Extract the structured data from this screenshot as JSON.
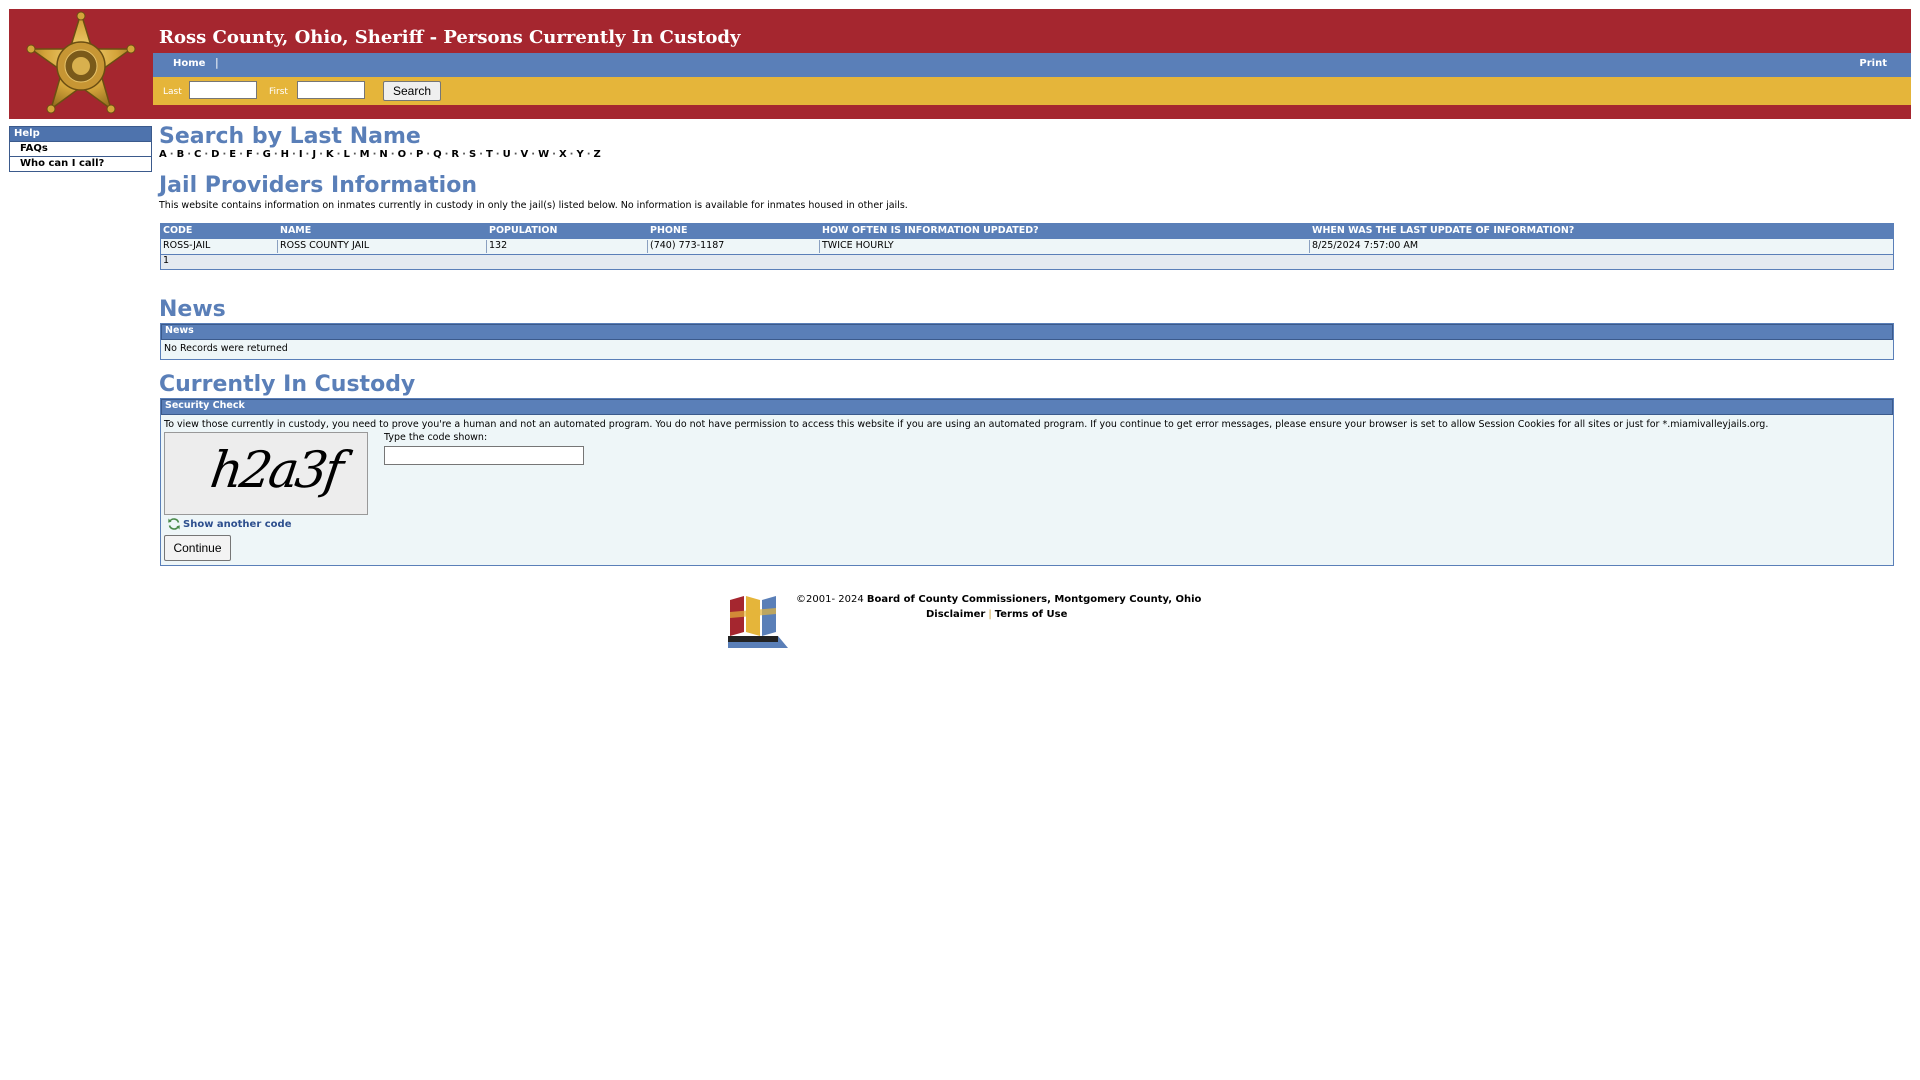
{
  "header": {
    "title": "Ross County, Ohio, Sheriff - Persons Currently In Custody",
    "badge_icon": "sheriff-star-badge",
    "colors": {
      "red": "#a5262f",
      "blue": "#5a7fb8",
      "gold": "#e5b53a"
    }
  },
  "nav": {
    "home": "Home",
    "separator": "|",
    "print": "Print"
  },
  "search": {
    "last_label": "Last",
    "first_label": "First",
    "last_value": "",
    "first_value": "",
    "button": "Search"
  },
  "leftmenu": {
    "title": "Help",
    "items": [
      "FAQs",
      "Who can I call?"
    ]
  },
  "search_by_last_name": {
    "heading": "Search by Last Name",
    "letters": [
      "A",
      "B",
      "C",
      "D",
      "E",
      "F",
      "G",
      "H",
      "I",
      "J",
      "K",
      "L",
      "M",
      "N",
      "O",
      "P",
      "Q",
      "R",
      "S",
      "T",
      "U",
      "V",
      "W",
      "X",
      "Y",
      "Z"
    ]
  },
  "providers": {
    "heading": "Jail Providers Information",
    "intro": "This website contains information on inmates currently in custody in only the jail(s) listed below. No information is available for inmates housed in other jails.",
    "columns": [
      "CODE",
      "NAME",
      "POPULATION",
      "PHONE",
      "HOW OFTEN IS INFORMATION UPDATED?",
      "WHEN WAS THE LAST UPDATE OF INFORMATION?"
    ],
    "rows": [
      [
        "ROSS-JAIL",
        "ROSS COUNTY JAIL",
        "132",
        "(740) 773-1187",
        "TWICE HOURLY",
        "8/25/2024 7:57:00 AM"
      ]
    ],
    "pager": "1"
  },
  "news": {
    "heading": "News",
    "table_header": "News",
    "empty": "No Records were returned"
  },
  "custody": {
    "heading": "Currently In Custody",
    "panel_header": "Security Check",
    "message": "To view those currently in custody, you need to prove you're a human and not an automated program. You do not have permission to access this website if you are using an automated program. If you continue to get error messages, please ensure your browser is set to allow Session Cookies for all sites or just for *.miamivalleyjails.org.",
    "captcha_text": "h2a3f",
    "code_label": "Type the code shown:",
    "code_value": "",
    "refresh": "Show another code",
    "continue": "Continue"
  },
  "footer": {
    "logo_icon": "montgomery-county-logo",
    "copyright_prefix": "©2001- 2024",
    "copyright_owner": "Board of County Commissioners, Montgomery County, Ohio",
    "disclaimer": "Disclaimer",
    "separator": "|",
    "terms": "Terms of Use"
  }
}
